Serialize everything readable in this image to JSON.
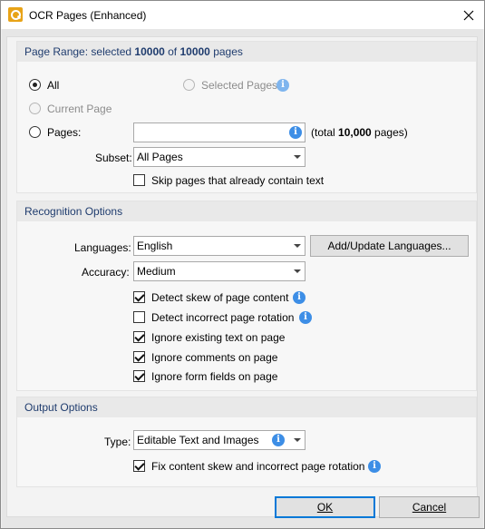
{
  "window": {
    "title": "OCR Pages (Enhanced)"
  },
  "page_range": {
    "header_prefix": "Page Range: selected ",
    "selected": "10000",
    "header_of": " of ",
    "total": "10000",
    "header_suffix": " pages",
    "all_label": "All",
    "selected_pages_label": "Selected Pages",
    "current_page_label": "Current Page",
    "pages_label": "Pages:",
    "pages_value": "",
    "total_prefix": "(total ",
    "total_count": "10,000",
    "total_suffix": " pages)",
    "subset_label": "Subset:",
    "subset_value": "All Pages",
    "skip_label": "Skip pages that already contain text",
    "skip_checked": false
  },
  "recognition": {
    "header": "Recognition Options",
    "languages_label": "Languages:",
    "languages_value": "English",
    "add_update_button": "Add/Update Languages...",
    "accuracy_label": "Accuracy:",
    "accuracy_value": "Medium",
    "options": [
      {
        "label": "Detect skew of page content",
        "checked": true,
        "info": true
      },
      {
        "label": "Detect incorrect page rotation",
        "checked": false,
        "info": true
      },
      {
        "label": "Ignore existing text on page",
        "checked": true,
        "info": false
      },
      {
        "label": "Ignore comments on page",
        "checked": true,
        "info": false
      },
      {
        "label": "Ignore form fields on page",
        "checked": true,
        "info": false
      }
    ]
  },
  "output": {
    "header": "Output Options",
    "type_label": "Type:",
    "type_value": "Editable Text and Images",
    "fix_label": "Fix content skew and incorrect page rotation",
    "fix_checked": true
  },
  "buttons": {
    "ok": "OK",
    "cancel": "Cancel"
  },
  "icons": {
    "info": "i"
  },
  "colors": {
    "header_text": "#1f3c6e",
    "info_blue": "#3d8ee6",
    "accent": "#0078d7"
  }
}
